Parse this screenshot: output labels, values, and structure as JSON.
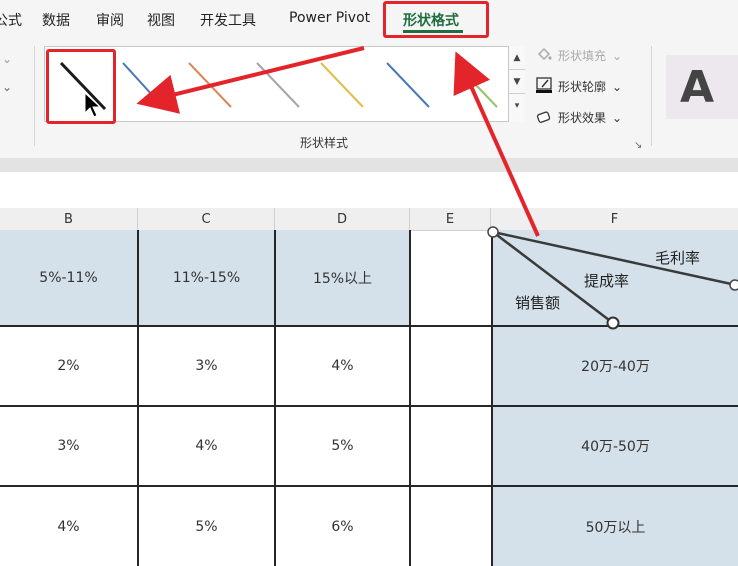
{
  "tabs": {
    "partial_left": "公式",
    "items": [
      "数据",
      "审阅",
      "视图",
      "开发工具",
      "Power Pivot"
    ],
    "active": "形状格式"
  },
  "ribbon": {
    "group_label": "形状样式",
    "shape_fill": "形状填充",
    "shape_outline": "形状轮廓",
    "shape_effects": "形状效果",
    "wordart_sample": "A",
    "line_style_colors": [
      "#1a1a1a",
      "#4a78b8",
      "#d8875a",
      "#a6a6a6",
      "#e0be4a",
      "#4a78b8",
      "#9ac16a"
    ]
  },
  "sheet": {
    "columns": [
      "B",
      "C",
      "D",
      "E",
      "F"
    ],
    "header_row": [
      "5%-11%",
      "11%-15%",
      "15%以上"
    ],
    "rows": [
      [
        "2%",
        "3%",
        "4%"
      ],
      [
        "3%",
        "4%",
        "5%"
      ],
      [
        "4%",
        "5%",
        "6%"
      ]
    ],
    "f_header": {
      "top_right": "毛利率",
      "middle": "提成率",
      "bottom_left": "销售额"
    },
    "f_rows": [
      "20万-40万",
      "40万-50万",
      "50万以上"
    ]
  },
  "colors": {
    "accent_green": "#1e6e3f",
    "highlight_red": "#e3252b",
    "cell_blue": "#d5e1ea"
  }
}
